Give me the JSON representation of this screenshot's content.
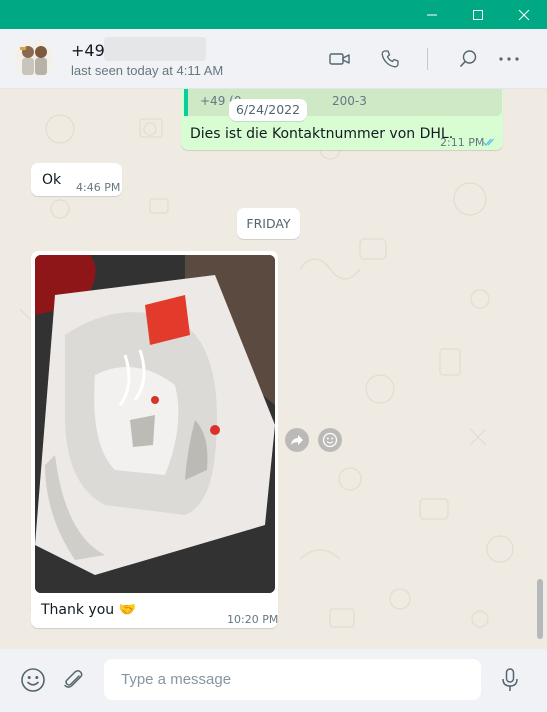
{
  "window": {
    "minimize_icon": "minimize-icon",
    "maximize_icon": "maximize-icon",
    "close_icon": "close-icon"
  },
  "header": {
    "contact_name": "+49 1",
    "status": "last seen today at 4:11 AM",
    "icons": [
      "video-call-icon",
      "voice-call-icon",
      "search-icon",
      "menu-dots-icon"
    ]
  },
  "messages": [
    {
      "direction": "outgoing",
      "quoted_text": "+49 (0",
      "quoted_tail": "200-3",
      "text": "Dies ist die Kontaktnummer von DHL.",
      "time": "2:11 PM",
      "status_icon": "double-check-icon"
    },
    {
      "direction": "incoming",
      "text": "Ok",
      "time": "4:46 PM"
    },
    {
      "direction": "incoming",
      "type": "image",
      "caption": "Thank you 🤝",
      "time": "10:20 PM"
    }
  ],
  "date_pills": {
    "floating": "6/24/2022",
    "friday": "FRIDAY"
  },
  "media_actions": [
    "forward-icon",
    "emoji-react-icon"
  ],
  "composer": {
    "placeholder": "Type a message",
    "icons": [
      "emoji-icon",
      "attach-icon",
      "microphone-icon"
    ]
  },
  "colors": {
    "titlebar": "#00a884",
    "outgoing_bubble": "#d9fdd3",
    "incoming_bubble": "#ffffff",
    "chat_background": "#efeae2",
    "read_ticks": "#53bdeb"
  }
}
